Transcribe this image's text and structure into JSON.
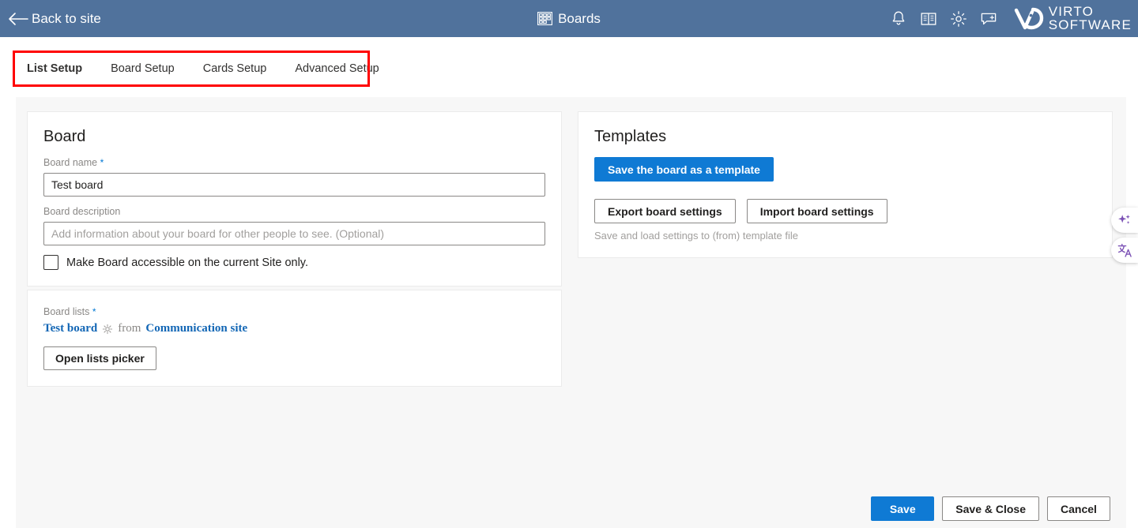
{
  "header": {
    "back_label": "Back to site",
    "app_title": "Boards",
    "icons": [
      "bell-icon",
      "book-icon",
      "gear-icon",
      "feedback-icon"
    ],
    "brand_line1": "VIRTO",
    "brand_line2": "SOFTWARE",
    "bar_color": "#50729c"
  },
  "tabs": {
    "highlight_color": "#ff0000",
    "items": [
      {
        "label": "List Setup",
        "active": true
      },
      {
        "label": "Board Setup",
        "active": false
      },
      {
        "label": "Cards Setup",
        "active": false
      },
      {
        "label": "Advanced Setup",
        "active": false
      }
    ]
  },
  "board_card": {
    "title": "Board",
    "name_label": "Board name",
    "name_required": "*",
    "name_value": "Test board",
    "description_label": "Board description",
    "description_value": "",
    "description_placeholder": "Add information about your board for other people to see. (Optional)",
    "site_only_label": "Make Board accessible on the current Site only.",
    "site_only_checked": false
  },
  "lists_card": {
    "label": "Board lists",
    "required": "*",
    "list_name": "Test board",
    "from_word": "from",
    "site_name": "Communication site",
    "picker_button": "Open lists picker"
  },
  "templates_card": {
    "title": "Templates",
    "save_template_button": "Save the board as a template",
    "export_button": "Export board settings",
    "import_button": "Import board settings",
    "hint": "Save and load settings to (from) template file",
    "primary_color": "#0f7ad4"
  },
  "float_widgets": [
    {
      "name": "ai-sparkles-icon"
    },
    {
      "name": "translate-icon"
    }
  ],
  "footer": {
    "save_label": "Save",
    "save_close_label": "Save & Close",
    "cancel_label": "Cancel"
  }
}
